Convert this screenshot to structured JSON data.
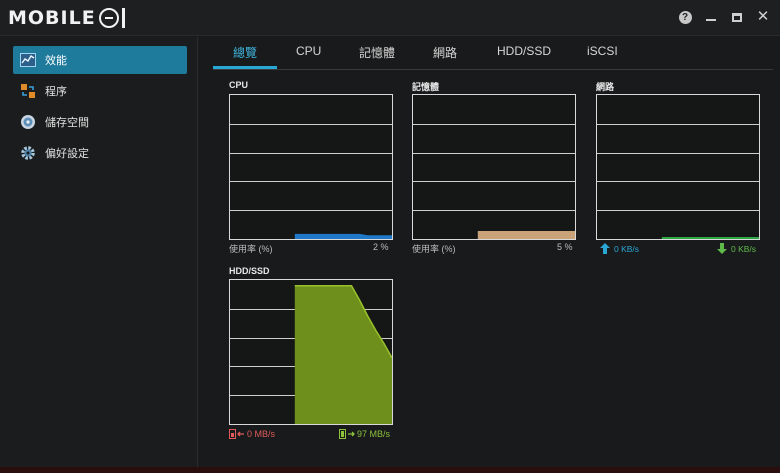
{
  "app": {
    "logo_text": "MOBILE",
    "colors": {
      "accent": "#1f7b9b",
      "tab_active": "#3fb6e0",
      "cpu": "#1f78c8",
      "memory": "#c9a27a",
      "network": "#2fa846",
      "disk": "#6f8f1c",
      "disk_line": "#98c22a"
    }
  },
  "window_controls": [
    {
      "name": "help-icon",
      "label": "?"
    },
    {
      "name": "minimize-icon"
    },
    {
      "name": "maximize-icon"
    },
    {
      "name": "close-icon",
      "label": "✕"
    }
  ],
  "sidebar": {
    "items": [
      {
        "label": "效能",
        "icon": "performance-chart-icon",
        "active": true
      },
      {
        "label": "程序",
        "icon": "process-icon",
        "active": false
      },
      {
        "label": "儲存空間",
        "icon": "storage-icon",
        "active": false
      },
      {
        "label": "偏好設定",
        "icon": "gear-icon",
        "active": false
      }
    ]
  },
  "tabs": [
    {
      "label": "總覽",
      "active": true
    },
    {
      "label": "CPU",
      "active": false
    },
    {
      "label": "記憶體",
      "active": false
    },
    {
      "label": "網路",
      "active": false
    },
    {
      "label": "HDD/SSD",
      "active": false
    },
    {
      "label": "iSCSI",
      "active": false
    }
  ],
  "panels": {
    "cpu": {
      "title": "CPU",
      "foot_label": "使用率 (%)",
      "foot_value": "2 %"
    },
    "memory": {
      "title": "記憶體",
      "foot_label": "使用率 (%)",
      "foot_value": "5 %"
    },
    "network": {
      "title": "網路",
      "up_value": "0 KB/s",
      "down_value": "0 KB/s"
    },
    "disk": {
      "title": "HDD/SSD",
      "read_value": "0 MB/s",
      "write_value": "97 MB/s"
    }
  },
  "chart_data": [
    {
      "type": "area",
      "title": "CPU",
      "ylabel": "使用率 (%)",
      "ylim": [
        0,
        100
      ],
      "x": [
        0,
        1,
        2,
        3,
        4,
        5,
        6,
        7,
        8,
        9,
        10,
        11,
        12,
        13,
        14,
        15,
        16,
        17,
        18,
        19,
        20
      ],
      "series": [
        {
          "values": [
            0,
            0,
            0,
            0,
            0,
            0,
            0,
            0,
            0,
            0,
            0,
            0,
            0,
            0,
            0,
            0,
            0,
            0,
            0,
            0,
            0
          ],
          "values_display": [
            null,
            null,
            null,
            null,
            null,
            null,
            null,
            null,
            3,
            3,
            3,
            3,
            3,
            3,
            3,
            3,
            3,
            2,
            2,
            2,
            2
          ]
        }
      ],
      "color": "#1f78c8"
    },
    {
      "type": "area",
      "title": "記憶體",
      "ylabel": "使用率 (%)",
      "ylim": [
        0,
        100
      ],
      "x": [
        0,
        1,
        2,
        3,
        4,
        5,
        6,
        7,
        8,
        9,
        10,
        11,
        12,
        13,
        14,
        15,
        16,
        17,
        18,
        19,
        20
      ],
      "series": [
        {
          "values": [
            null,
            null,
            null,
            null,
            null,
            null,
            null,
            null,
            5,
            5,
            5,
            5,
            5,
            5,
            5,
            5,
            5,
            5,
            5,
            5,
            5
          ]
        }
      ],
      "color": "#c9a27a"
    },
    {
      "type": "line",
      "title": "網路",
      "ylim": [
        0,
        100
      ],
      "x": [
        0,
        1,
        2,
        3,
        4,
        5,
        6,
        7,
        8,
        9,
        10,
        11,
        12,
        13,
        14,
        15,
        16,
        17,
        18,
        19,
        20
      ],
      "series": [
        {
          "values": [
            null,
            null,
            null,
            null,
            null,
            null,
            null,
            null,
            0,
            0,
            0,
            0,
            0,
            0,
            0,
            0,
            0,
            0,
            0,
            0,
            0
          ]
        }
      ],
      "color": "#2fa846"
    },
    {
      "type": "area",
      "title": "HDD/SSD",
      "ylim": [
        0,
        100
      ],
      "x": [
        0,
        1,
        2,
        3,
        4,
        5,
        6,
        7,
        8,
        9,
        10,
        11,
        12,
        13,
        14,
        15,
        16,
        17,
        18,
        19,
        20
      ],
      "series": [
        {
          "values": [
            null,
            null,
            null,
            null,
            null,
            null,
            null,
            null,
            96,
            96,
            96,
            96,
            96,
            96,
            96,
            96,
            86,
            75,
            65,
            56,
            46
          ]
        }
      ],
      "color": "#6f8f1c"
    }
  ]
}
